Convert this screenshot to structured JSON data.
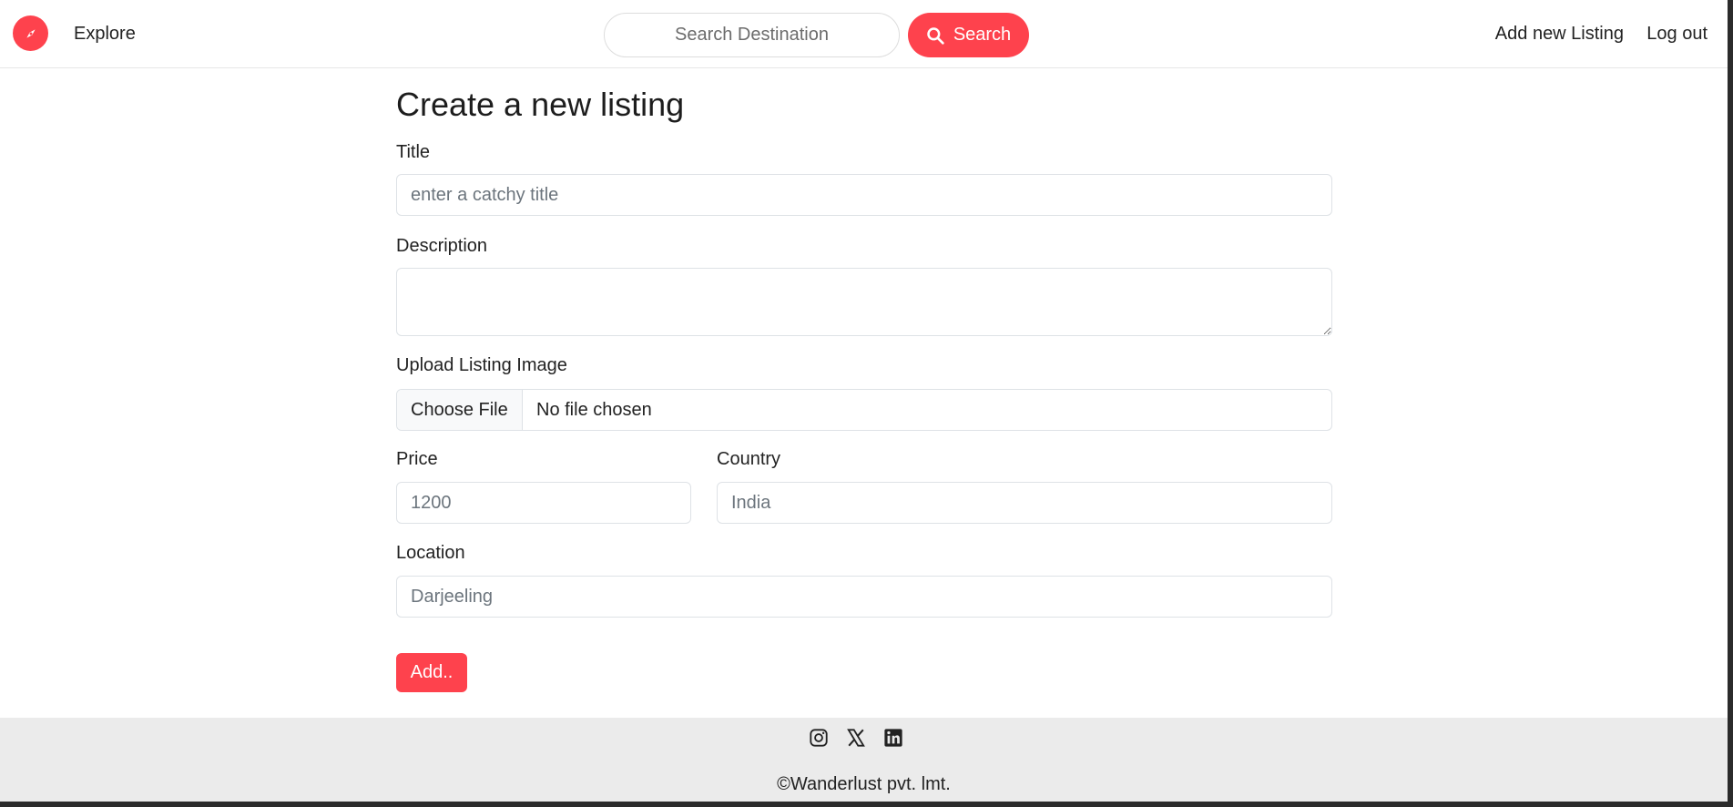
{
  "nav": {
    "explore_label": "Explore",
    "search_placeholder": "Search Destination",
    "search_button_label": "Search",
    "add_listing_label": "Add new Listing",
    "logout_label": "Log out",
    "logo_icon": "compass-icon",
    "search_icon": "magnifier-icon"
  },
  "form": {
    "page_title": "Create a new listing",
    "title_label": "Title",
    "title_placeholder": "enter a catchy title",
    "description_label": "Description",
    "description_value": "",
    "image_label": "Upload Listing Image",
    "file_button_label": "Choose File",
    "file_status": "No file chosen",
    "price_label": "Price",
    "price_placeholder": "1200",
    "country_label": "Country",
    "country_placeholder": "India",
    "location_label": "Location",
    "location_placeholder": "Darjeeling",
    "submit_label": "Add.."
  },
  "footer": {
    "socials": [
      "instagram-icon",
      "x-twitter-icon",
      "linkedin-icon"
    ],
    "copyright": "©Wanderlust pvt. lmt."
  },
  "colors": {
    "brand": "#fe424d",
    "footer_bg": "#ebebeb",
    "border": "#dee2e6"
  }
}
